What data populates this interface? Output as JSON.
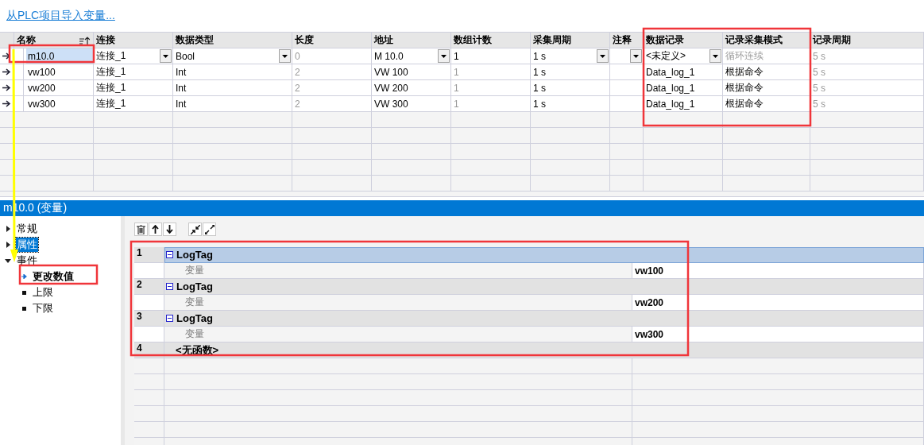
{
  "import_link": "从PLC项目导入变量...",
  "table": {
    "columns": [
      "名称",
      "连接",
      "数据类型",
      "长度",
      "地址",
      "数组计数",
      "采集周期",
      "注释",
      "数据记录",
      "记录采集模式",
      "记录周期"
    ],
    "rows": [
      {
        "name": "m10.0",
        "connection": "连接_1",
        "data_type": "Bool",
        "length": "0",
        "address": "M 10.0",
        "array_count": "1",
        "cycle": "1 s",
        "log": "<未定义>",
        "mode": "循环连续",
        "log_cycle": "5 s",
        "editing": true
      },
      {
        "name": "vw100",
        "connection": "连接_1",
        "data_type": "Int",
        "length": "2",
        "address": "VW 100",
        "array_count": "1",
        "cycle": "1 s",
        "log": "Data_log_1",
        "mode": "根据命令",
        "log_cycle": "5 s",
        "editing": false
      },
      {
        "name": "vw200",
        "connection": "连接_1",
        "data_type": "Int",
        "length": "2",
        "address": "VW 200",
        "array_count": "1",
        "cycle": "1 s",
        "log": "Data_log_1",
        "mode": "根据命令",
        "log_cycle": "5 s",
        "editing": false
      },
      {
        "name": "vw300",
        "connection": "连接_1",
        "data_type": "Int",
        "length": "2",
        "address": "VW 300",
        "array_count": "1",
        "cycle": "1 s",
        "log": "Data_log_1",
        "mode": "根据命令",
        "log_cycle": "5 s",
        "editing": false
      }
    ]
  },
  "panel": {
    "title": "m10.0 (变量)",
    "tree": [
      {
        "label": "常规",
        "expanded": false,
        "selected": false
      },
      {
        "label": "属性",
        "expanded": false,
        "selected": true
      },
      {
        "label": "事件",
        "expanded": true,
        "selected": false,
        "children": [
          {
            "label": "更改数值",
            "selected": true
          },
          {
            "label": "上限",
            "selected": false
          },
          {
            "label": "下限",
            "selected": false
          }
        ]
      }
    ],
    "functions": [
      {
        "number": "1",
        "name": "LogTag",
        "selected": true,
        "expanded": true,
        "params": [
          {
            "name": "变量",
            "value": "vw100"
          }
        ]
      },
      {
        "number": "2",
        "name": "LogTag",
        "selected": false,
        "expanded": true,
        "params": [
          {
            "name": "变量",
            "value": "vw200"
          }
        ]
      },
      {
        "number": "3",
        "name": "LogTag",
        "selected": false,
        "expanded": true,
        "params": [
          {
            "name": "变量",
            "value": "vw300"
          }
        ]
      },
      {
        "number": "4",
        "name": "<无函数>",
        "selected": false
      }
    ]
  }
}
